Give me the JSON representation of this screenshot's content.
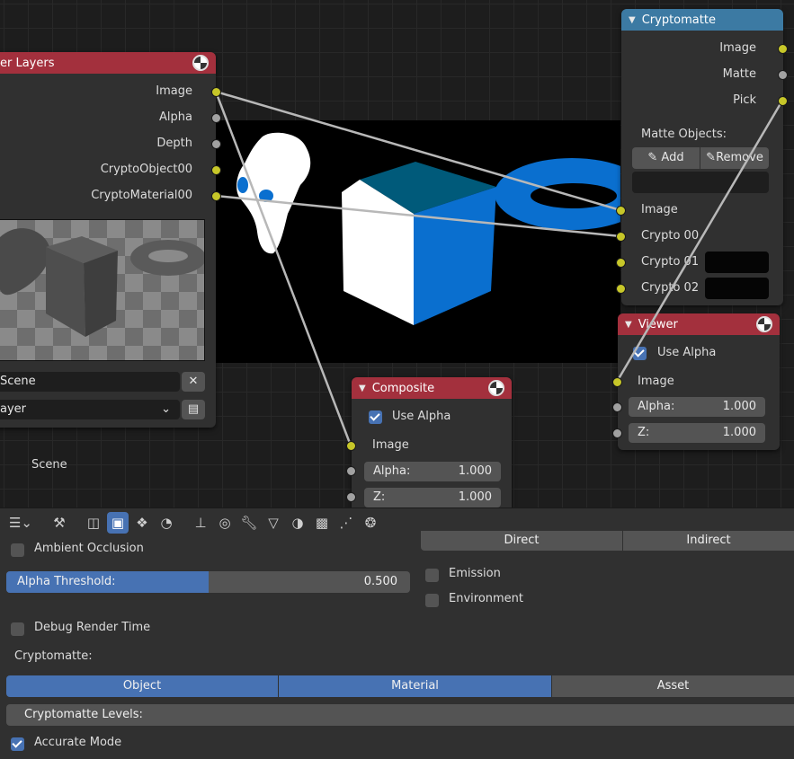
{
  "render_layers_node": {
    "title": "er Layers",
    "outputs": [
      "Image",
      "Alpha",
      "Depth",
      "CryptoObject00",
      "CryptoMaterial00"
    ],
    "scene_field": "Scene",
    "layer_field": "ayer",
    "below_label": "Scene"
  },
  "cryptomatte_node": {
    "title": "Cryptomatte",
    "outputs": [
      "Image",
      "Matte",
      "Pick"
    ],
    "matte_objects_label": "Matte Objects:",
    "add_label": "Add",
    "remove_label": "Remove",
    "inputs": [
      "Image",
      "Crypto 00",
      "Crypto 01",
      "Crypto 02"
    ]
  },
  "viewer_node": {
    "title": "Viewer",
    "use_alpha_label": "Use Alpha",
    "image_label": "Image",
    "alpha_label": "Alpha:",
    "alpha_value": "1.000",
    "z_label": "Z:",
    "z_value": "1.000"
  },
  "composite_node": {
    "title": "Composite",
    "use_alpha_label": "Use Alpha",
    "image_label": "Image",
    "alpha_label": "Alpha:",
    "alpha_value": "1.000",
    "z_label": "Z:",
    "z_value": "1.000"
  },
  "properties": {
    "ambient_occlusion": "Ambient Occlusion",
    "alpha_threshold_label": "Alpha Threshold:",
    "alpha_threshold_value": "0.500",
    "alpha_threshold_fraction": 0.5,
    "direct_label": "Direct",
    "indirect_label": "Indirect",
    "emission_label": "Emission",
    "environment_label": "Environment",
    "debug_render_time": "Debug Render Time",
    "cryptomatte_label": "Cryptomatte:",
    "segments": [
      "Object",
      "Material",
      "Asset"
    ],
    "cryptomatte_levels_label": "Cryptomatte Levels:",
    "accurate_mode": "Accurate Mode"
  },
  "toolbar_icons": [
    "editor-type-icon",
    "tool-icon",
    "render-icon",
    "output-icon",
    "view-layer-icon",
    "scene-icon",
    "world-icon",
    "object-icon",
    "modifier-icon",
    "particles-icon",
    "physics-icon",
    "constraints-icon",
    "data-icon",
    "material-icon",
    "texture-icon"
  ],
  "colors": {
    "accent": "#4772b3",
    "node_header_red": "#a3303d",
    "node_header_blue": "#3c7aa3",
    "socket_yellow": "#c7c729",
    "socket_gray": "#a1a1a1",
    "matte_blue": "#0a6fcf"
  }
}
